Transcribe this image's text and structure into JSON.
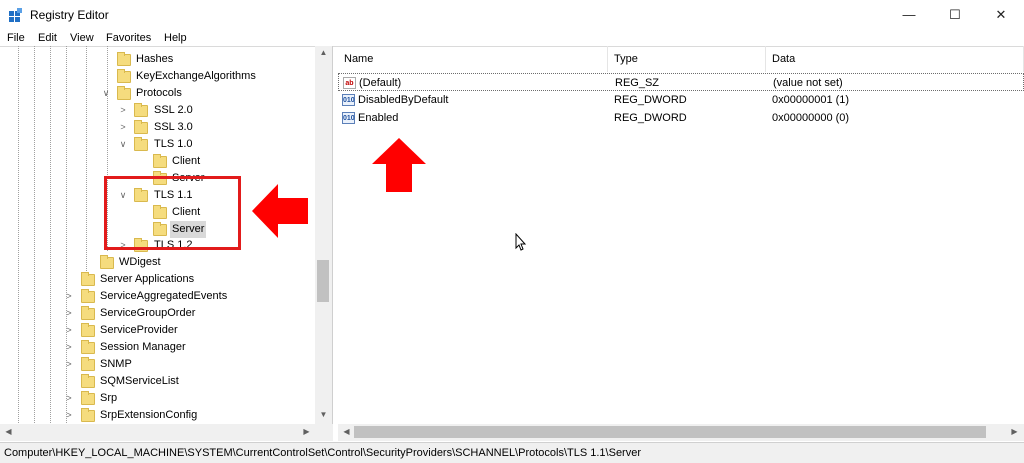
{
  "window": {
    "title": "Registry Editor",
    "minimize_glyph": "—",
    "maximize_glyph": "☐",
    "close_glyph": "✕"
  },
  "menu": [
    "File",
    "Edit",
    "View",
    "Favorites",
    "Help"
  ],
  "tree": {
    "items": [
      {
        "label": "Hashes",
        "expander": ""
      },
      {
        "label": "KeyExchangeAlgorithms",
        "expander": ""
      },
      {
        "label": "Protocols",
        "expander": "∨"
      },
      {
        "label": "SSL 2.0",
        "expander": ">"
      },
      {
        "label": "SSL 3.0",
        "expander": ">"
      },
      {
        "label": "TLS 1.0",
        "expander": "∨"
      },
      {
        "label": "Client",
        "expander": ""
      },
      {
        "label": "Server",
        "expander": ""
      },
      {
        "label": "TLS 1.1",
        "expander": "∨"
      },
      {
        "label": "Client",
        "expander": ""
      },
      {
        "label": "Server",
        "expander": "",
        "selected": true
      },
      {
        "label": "TLS 1.2",
        "expander": ">"
      },
      {
        "label": "WDigest",
        "expander": ""
      },
      {
        "label": "Server Applications",
        "expander": ""
      },
      {
        "label": "ServiceAggregatedEvents",
        "expander": ">"
      },
      {
        "label": "ServiceGroupOrder",
        "expander": ">"
      },
      {
        "label": "ServiceProvider",
        "expander": ">"
      },
      {
        "label": "Session Manager",
        "expander": ">"
      },
      {
        "label": "SNMP",
        "expander": ">"
      },
      {
        "label": "SQMServiceList",
        "expander": ""
      },
      {
        "label": "Srp",
        "expander": ">"
      },
      {
        "label": "SrpExtensionConfig",
        "expander": ">"
      }
    ]
  },
  "columns": {
    "name": "Name",
    "type": "Type",
    "data": "Data"
  },
  "values": [
    {
      "icon": "ab",
      "name": "(Default)",
      "type": "REG_SZ",
      "data": "(value not set)"
    },
    {
      "icon": "010",
      "name": "DisabledByDefault",
      "type": "REG_DWORD",
      "data": "0x00000001 (1)"
    },
    {
      "icon": "010",
      "name": "Enabled",
      "type": "REG_DWORD",
      "data": "0x00000000 (0)"
    }
  ],
  "status_path": "Computer\\HKEY_LOCAL_MACHINE\\SYSTEM\\CurrentControlSet\\Control\\SecurityProviders\\SCHANNEL\\Protocols\\TLS 1.1\\Server",
  "colors": {
    "annotation": "#e21b1b",
    "folder": "#f5dc7e",
    "selection": "#d9d9d9"
  },
  "icons": [
    "registry-app-icon",
    "folder-icon",
    "string-value-icon",
    "binary-value-icon",
    "mouse-cursor-icon",
    "red-arrow-left-icon",
    "red-arrow-up-icon"
  ]
}
